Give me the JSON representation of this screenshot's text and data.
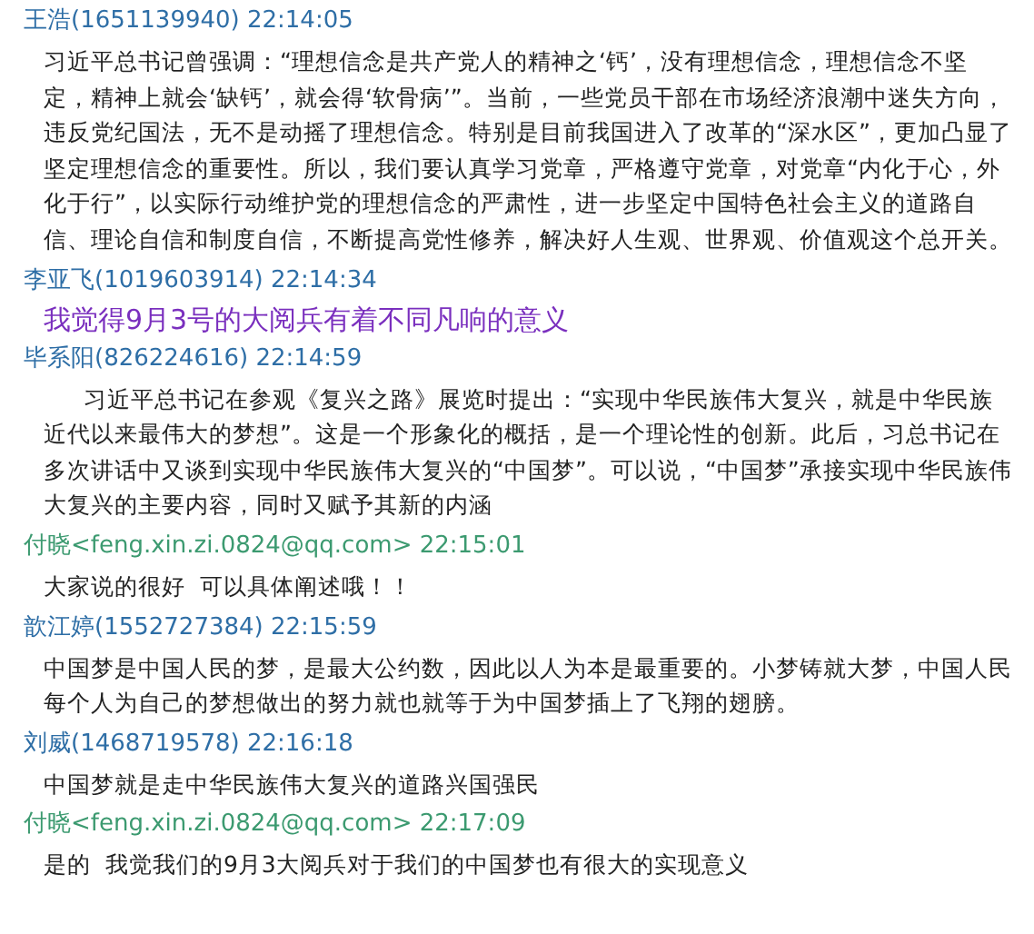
{
  "messages": [
    {
      "sender": "王浩(1651139940) 22:14:05",
      "color": "#2e6ea6",
      "kind": "normal",
      "text": "习近平总书记曾强调：“理想信念是共产党人的精神之‘钙’，没有理想信念，理想信念不坚定，精神上就会‘缺钙’，就会得‘软骨病’”。当前，一些党员干部在市场经济浪潮中迷失方向，违反党纪国法，无不是动摇了理想信念。特别是目前我国进入了改革的“深水区”，更加凸显了坚定理想信念的重要性。所以，我们要认真学习党章，严格遵守党章，对党章“内化于心，外化于行”，以实际行动维护党的理想信念的严肃性，进一步坚定中国特色社会主义的道路自信、理论自信和制度自信，不断提高党性修养，解决好人生观、世界观、价值观这个总开关。"
    },
    {
      "sender": "李亚飞(1019603914) 22:14:34",
      "color": "#2e6ea6",
      "kind": "highlight",
      "text": "我觉得9月3号的大阅兵有着不同凡响的意义"
    },
    {
      "sender": "毕系阳(826224616) 22:14:59",
      "color": "#2e6ea6",
      "kind": "indented",
      "text": "习近平总书记在参观《复兴之路》展览时提出：“实现中华民族伟大复兴，就是中华民族近代以来最伟大的梦想”。这是一个形象化的概括，是一个理论性的创新。此后，习总书记在多次讲话中又谈到实现中华民族伟大复兴的“中国梦”。可以说，“中国梦”承接实现中华民族伟大复兴的主要内容，同时又赋予其新的内涵"
    },
    {
      "sender": "付晓<feng.xin.zi.0824@qq.com> 22:15:01",
      "color": "#3c9a70",
      "kind": "normal",
      "text": "大家说的很好  可以具体阐述哦！！"
    },
    {
      "sender": "歆江婷(1552727384) 22:15:59",
      "color": "#2e6ea6",
      "kind": "normal",
      "text": "中国梦是中国人民的梦，是最大公约数，因此以人为本是最重要的。小梦铸就大梦，中国人民每个人为自己的梦想做出的努力就也就等于为中国梦插上了飞翔的翅膀。"
    },
    {
      "sender": "刘威(1468719578) 22:16:18",
      "color": "#2e6ea6",
      "kind": "normal",
      "text": "中国梦就是走中华民族伟大复兴的道路兴国强民"
    },
    {
      "sender": "付晓<feng.xin.zi.0824@qq.com> 22:17:09",
      "color": "#3c9a70",
      "kind": "normal",
      "text": "是的  我觉我们的9月3大阅兵对于我们的中国梦也有很大的实现意义"
    }
  ]
}
